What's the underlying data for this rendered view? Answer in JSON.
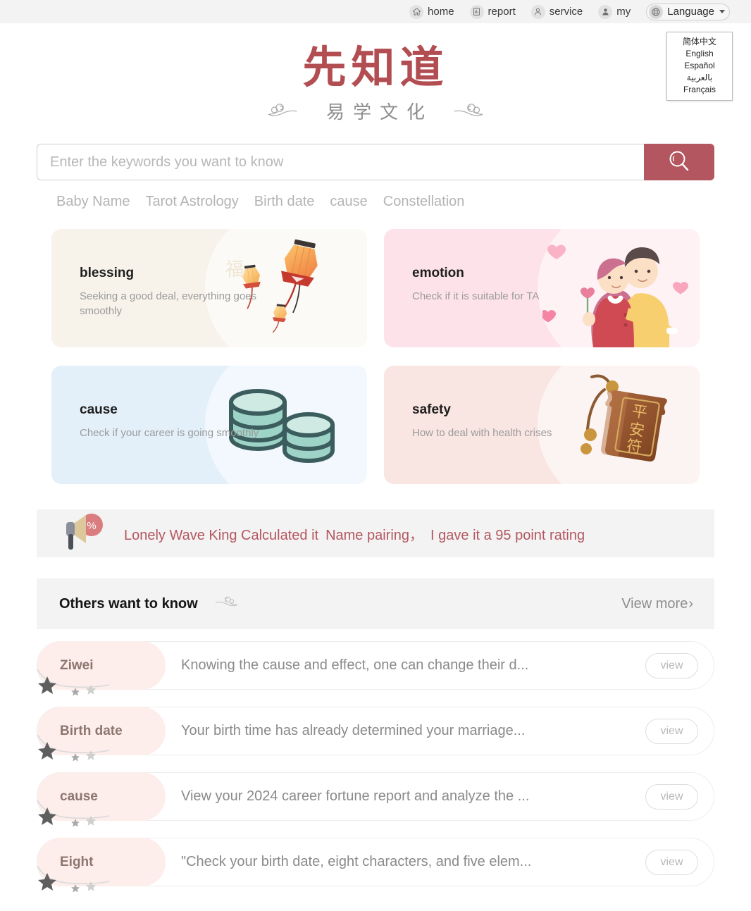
{
  "topnav": {
    "items": [
      {
        "label": "home",
        "icon": "home-icon"
      },
      {
        "label": "report",
        "icon": "report-icon"
      },
      {
        "label": "service",
        "icon": "service-icon"
      },
      {
        "label": "my",
        "icon": "user-icon"
      }
    ],
    "language": {
      "label": "Language",
      "icon": "globe-icon",
      "caret": "chevron-down-icon",
      "open": true,
      "options": [
        "简体中文",
        "English",
        "Español",
        "بالعربية",
        "Français"
      ]
    }
  },
  "logo": {
    "main": "先知道",
    "sub": "易学文化",
    "main_color": "#b24d52",
    "sub_color": "#8d8d8d"
  },
  "search": {
    "value": "",
    "placeholder": "Enter the keywords you want to know",
    "button_icon": "search-icon",
    "button_color": "#b4565f",
    "tags": [
      "Baby Name",
      "Tarot Astrology",
      "Birth date",
      "cause",
      "Constellation"
    ]
  },
  "cards": [
    {
      "key": "blessing",
      "title": "blessing",
      "desc": "Seeking a good deal, everything goes smoothly",
      "bg": "#f7f3ea",
      "art": "lantern-illustration"
    },
    {
      "key": "emotion",
      "title": "emotion",
      "desc": "Check if it is suitable for TA",
      "bg": "#fde3e9",
      "art": "couple-illustration"
    },
    {
      "key": "cause",
      "title": "cause",
      "desc": "Check if your career is going smoothly",
      "bg": "#e3f0fa",
      "art": "coins-illustration"
    },
    {
      "key": "safety",
      "title": "safety",
      "desc": "How to deal with health crises",
      "bg": "#f9e6e2",
      "art": "amulet-illustration"
    }
  ],
  "notice": {
    "icon": "megaphone-percent-icon",
    "part1": "Lonely Wave King Calculated it",
    "part2": "Name pairing",
    "comma": "，",
    "part3": "I gave it a 95 point rating",
    "color": "#b4565f"
  },
  "section": {
    "title": "Others want to know",
    "ornament": "cloud-ornament-icon",
    "view_more": "View more",
    "view_more_chevron": "›"
  },
  "list": {
    "view_label": "view",
    "rows": [
      {
        "tag": "Ziwei",
        "desc": "Knowing the cause and effect, one can change their d..."
      },
      {
        "tag": "Birth date",
        "desc": "Your birth time has already determined your marriage..."
      },
      {
        "tag": "cause",
        "desc": "View your 2024 career fortune report and analyze the ..."
      },
      {
        "tag": "Eight",
        "desc": "\"Check your birth date, eight characters, and five elem..."
      }
    ]
  }
}
